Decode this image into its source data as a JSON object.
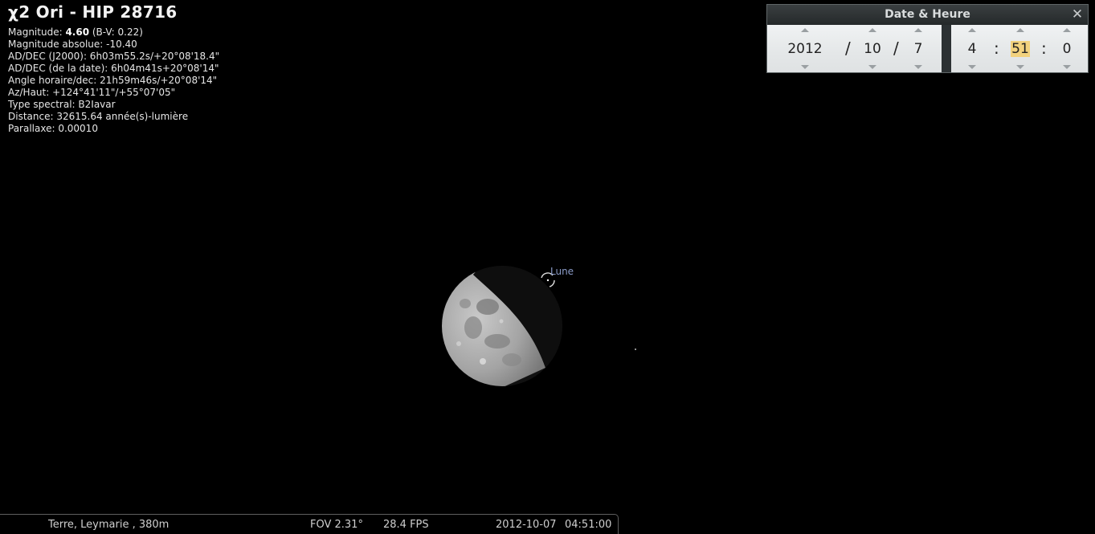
{
  "object_info": {
    "title": "χ2 Ori - HIP 28716",
    "magnitude_label": "Magnitude: ",
    "magnitude_value": "4.60",
    "magnitude_bv": " (B-V: 0.22)",
    "abs_magnitude": "Magnitude absolue: -10.40",
    "radec_j2000": "AD/DEC (J2000): 6h03m55.2s/+20°08'18.4\"",
    "radec_date": "AD/DEC (de la date): 6h04m41s+20°08'14\"",
    "hour_angle": "Angle horaire/dec: 21h59m46s/+20°08'14\"",
    "az_alt": "Az/Haut: +124°41'11\"/+55°07'05\"",
    "spectral_type": "Type spectral: B2Iavar",
    "distance": "Distance: 32615.64 année(s)-lumière",
    "parallax": "Parallaxe: 0.00010"
  },
  "sky": {
    "moon_label": "Lune"
  },
  "date_dialog": {
    "title": "Date & Heure",
    "close_glyph": "✕",
    "year": "2012",
    "month": "10",
    "day": "7",
    "hour": "4",
    "minute": "51",
    "second": "0",
    "date_separator": "/",
    "time_separator": ":"
  },
  "status_bar": {
    "location": "Terre, Leymarie , 380m",
    "fov": "FOV 2.31°",
    "fps": "28.4 FPS",
    "date": "2012-10-07",
    "time": "04:51:00"
  },
  "colors": {
    "background": "#000000",
    "moon_label": "#8a9bc8",
    "highlight": "#f2d27e"
  }
}
